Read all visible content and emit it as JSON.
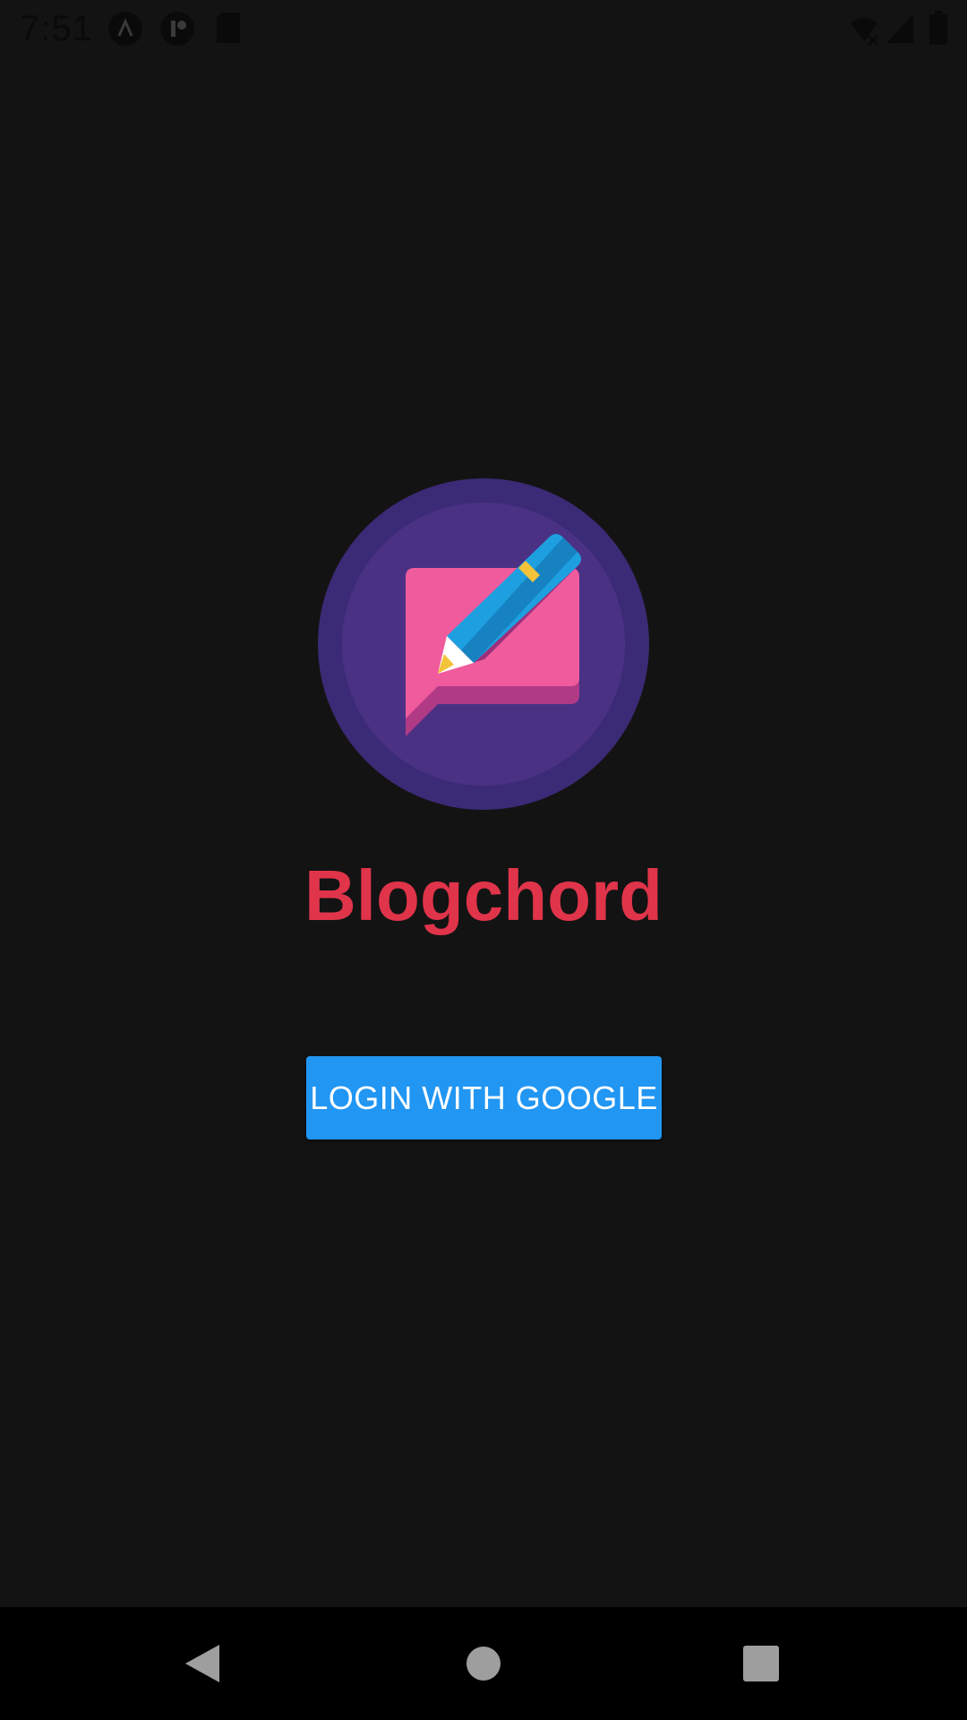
{
  "status_bar": {
    "time": "7:51",
    "icons": [
      "app-a-icon",
      "app-f-icon",
      "sd-card-icon",
      "wifi-off-icon",
      "signal-icon",
      "battery-icon"
    ]
  },
  "app": {
    "title": "Blogchord",
    "logo_icon": "blog-pencil-chat-icon"
  },
  "login": {
    "button_label": "LOGIN WITH GOOGLE"
  },
  "nav_bar": {
    "icons": [
      "back-icon",
      "home-icon",
      "recents-icon"
    ]
  },
  "colors": {
    "background": "#131313",
    "title": "#e0344a",
    "button": "#2196f3",
    "logo_outer": "#3b2a75",
    "logo_inner": "#4a3184",
    "bubble": "#f05b9d",
    "pencil": "#1ea0e0"
  }
}
